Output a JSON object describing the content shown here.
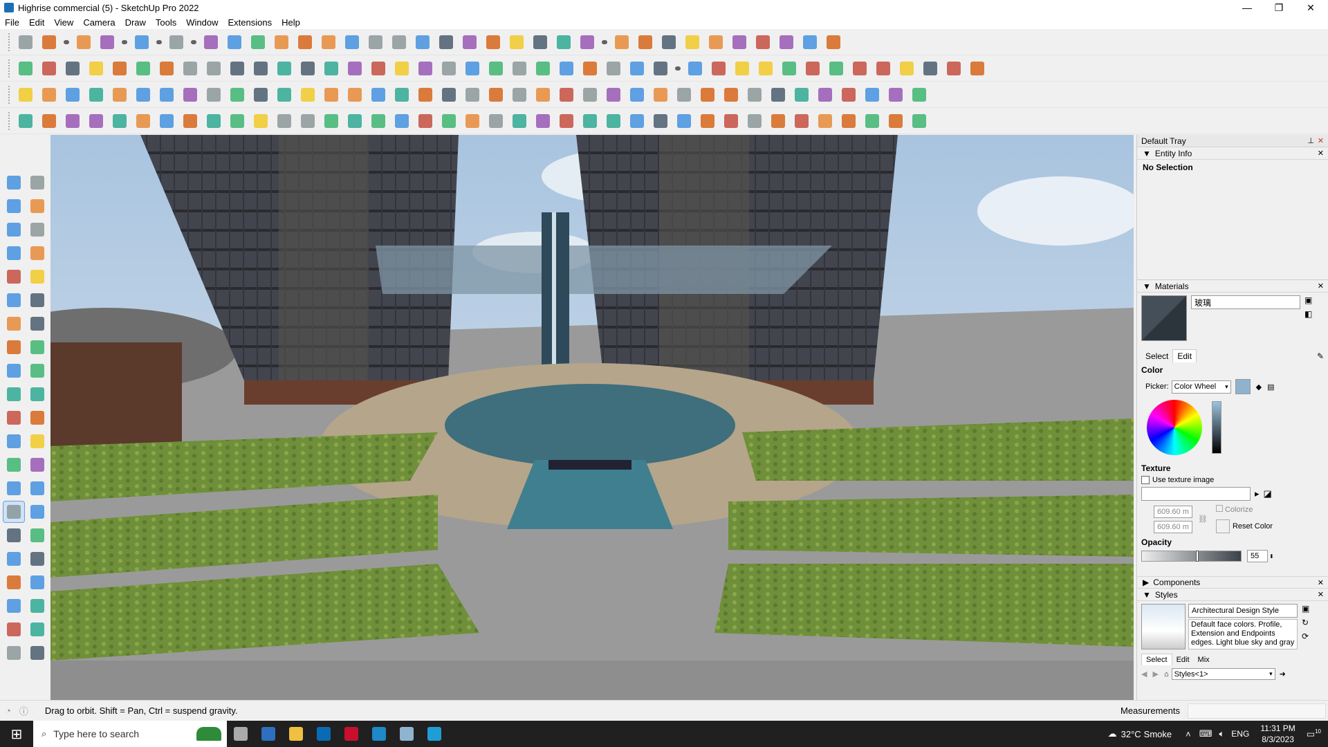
{
  "window": {
    "title": "Highrise commercial (5) - SketchUp Pro 2022",
    "minimize_icon": "minimize-icon",
    "maximize_icon": "maximize-icon",
    "close_icon": "close-icon",
    "minimize_glyph": "—",
    "maximize_glyph": "❐",
    "close_glyph": "✕"
  },
  "menubar": {
    "items": [
      "File",
      "Edit",
      "View",
      "Camera",
      "Draw",
      "Tools",
      "Window",
      "Extensions",
      "Help"
    ]
  },
  "toolbars": {
    "row1_icons": [
      "zoom-window-icon",
      "select-icon",
      "select-dropdown-icon",
      "eraser-icon",
      "pencil-line-icon",
      "line-dropdown-icon",
      "freehand-lasso-icon",
      "lasso-dropdown-icon",
      "shape-icon",
      "shape-dropdown-icon",
      "push-pull-icon",
      "follow-me-icon",
      "move-icon",
      "rotate-icon",
      "scale-icon",
      "tape-measure-icon",
      "text-icon",
      "paint-bucket-icon",
      "orbit-icon",
      "pan-icon",
      "zoom-icon",
      "zoom-extents-icon",
      "warehouse-icon",
      "extension-warehouse-icon",
      "layout-icon",
      "extension-manager-icon",
      "profile-icon",
      "profile-dropdown-icon",
      "sandbox-from-contours-icon",
      "sandbox-from-scratch-icon",
      "sandbox-smoove-icon",
      "sandbox-stamp-icon",
      "sandbox-drape-icon",
      "sandbox-add-detail-icon",
      "sandbox-flip-edge-icon",
      "undo-icon",
      "redo-icon",
      "hand-icon"
    ],
    "row2_icons": [
      "iso-view-icon",
      "top-view-icon",
      "front-view-icon",
      "component-icon",
      "group-icon",
      "section-plane-icon",
      "section-cut-icon",
      "section-fill-icon",
      "curve-icon",
      "solid-union-icon",
      "solid-subtract-icon",
      "solid-intersect-icon",
      "solid-trim-icon",
      "solid-split-icon",
      "outer-shell-icon",
      "sun-shadow-icon",
      "arrow-up-icon",
      "arrow-down-icon",
      "house-icon",
      "house-outline-icon",
      "building-icon",
      "roof-icon",
      "wall-icon",
      "floor-icon",
      "stair-icon",
      "window-icon",
      "door-icon",
      "fredo-icon",
      "dropdown-icon",
      "tag-icon",
      "knife-icon",
      "box-icon",
      "circle-icon",
      "polygon-icon",
      "ellipse-icon",
      "parallelogram-icon",
      "arc-icon",
      "spiral-icon",
      "star-icon",
      "curvilinear-icon",
      "joint-push-pull-icon",
      "hammer-icon"
    ],
    "row3_icons": [
      "plane-blue-icon",
      "plane-cyan-icon",
      "plane-yellow-icon",
      "plane-green-icon",
      "plane-red-icon",
      "plane-white-icon",
      "loop-icon",
      "square-red-icon",
      "frame-icon",
      "panel-icon",
      "wood-icon",
      "chain-icon",
      "corner-icon",
      "vertex-icon",
      "cross-red-icon",
      "cross-green-icon",
      "cross-blue-icon",
      "cone-icon",
      "fountain-icon",
      "triangle-icon",
      "spiral-orange-icon",
      "knot-icon",
      "circle-dashed-icon",
      "axes-icon",
      "cup-icon",
      "curl-icon",
      "tree-icon",
      "cube-red-icon",
      "cubes-icon",
      "cube-mixed-icon",
      "gem-icon",
      "grid-icon",
      "panel-blue-icon",
      "grid-orange-icon",
      "grid-yellow-icon",
      "grid-amber-icon",
      "dots-icon",
      "circle-dot-icon",
      "qr-icon"
    ],
    "row4_icons": [
      "curve-dashed-icon",
      "bezier-icon",
      "truck-icon",
      "scissors-icon",
      "gear-icon",
      "gear-outline-icon",
      "pipe-icon",
      "ring-icon",
      "sphere-icon",
      "cable-icon",
      "stair-line-icon",
      "step-icon",
      "divider-icon",
      "arc-red-icon",
      "arch-icon",
      "fan-icon",
      "bars-icon",
      "column-icon",
      "hand-outline-icon",
      "leaf-icon",
      "arrow-split-icon",
      "stack-icon",
      "blade-icon",
      "fork-icon",
      "rake-icon",
      "trident-icon",
      "sand-icon",
      "hatch-icon",
      "panel-gray-icon",
      "frame-gray-icon",
      "fence-icon",
      "mesh-icon",
      "grid-gray-icon",
      "comb-icon",
      "gear-dark-icon",
      "fan-dark-icon",
      "spikes-icon",
      "city-icon",
      "cube-outline-icon"
    ]
  },
  "left_toolbar_icons": [
    "select-icon",
    "make-component-icon",
    "paint-bucket-icon",
    "eraser-icon",
    "tag-tool-icon",
    "pencil-icon",
    "line-icon",
    "freehand-icon",
    "rectangle-icon",
    "rotated-rectangle-icon",
    "circle-icon",
    "polygon-icon",
    "arc-icon",
    "two-point-arc-icon",
    "three-point-arc-icon",
    "pie-icon",
    "move-icon",
    "push-pull-icon",
    "rotate-icon",
    "follow-me-icon",
    "scale-icon",
    "offset-icon",
    "tape-measure-icon",
    "dimension-icon",
    "protractor-icon",
    "text-icon",
    "axes-icon",
    "3d-text-icon",
    "orbit-icon",
    "pan-icon",
    "zoom-icon",
    "zoom-window-icon",
    "zoom-extents-icon",
    "previous-view-icon",
    "position-camera-icon",
    "look-around-icon",
    "walk-icon",
    "section-plane-icon",
    "warehouse-icon",
    "extension-warehouse-icon",
    "layout-send-icon",
    "extension-manager-icon"
  ],
  "active_tool": "orbit-icon",
  "tray": {
    "title": "Default Tray",
    "pin_icon": "pin-icon",
    "close_icon": "close-icon",
    "entity_info": {
      "label": "Entity Info",
      "selection": "No Selection"
    },
    "materials": {
      "label": "Materials",
      "name_value": "玻璃",
      "swatch_color": "#2f3a44",
      "tabs": [
        "Select",
        "Edit"
      ],
      "active_tab": "Edit",
      "color_section": "Color",
      "picker_label": "Picker:",
      "picker_value": "Color Wheel",
      "picker_options": [
        "Color Wheel"
      ],
      "current_color": "#8fb2cf",
      "texture_section": "Texture",
      "use_texture_label": "Use texture image",
      "use_texture_checked": false,
      "texture_path": "",
      "width_value": "609.60 m",
      "height_value": "609.60 m",
      "colorize_label": "Colorize",
      "reset_color_label": "Reset Color",
      "opacity_section": "Opacity",
      "opacity_value": "55"
    },
    "components": {
      "label": "Components"
    },
    "styles": {
      "label": "Styles",
      "name_value": "Architectural Design Style",
      "description": "Default face colors. Profile, Extension and Endpoints edges. Light blue sky and gray",
      "tabs": [
        "Select",
        "Edit",
        "Mix"
      ],
      "active_tab": "Select",
      "collection_value": "Styles<1>"
    }
  },
  "statusbar": {
    "hint": "Drag to orbit. Shift = Pan, Ctrl = suspend gravity.",
    "measurements_label": "Measurements",
    "measurements_value": ""
  },
  "taskbar": {
    "search_placeholder": "Type here to search",
    "weather_temp": "32°C",
    "weather_desc": "Smoke",
    "language": "ENG",
    "time": "11:31 PM",
    "date": "8/3/2023",
    "notification_count": "10",
    "apps": [
      "task-view-icon",
      "calculator-icon",
      "file-explorer-icon",
      "sketchup-icon",
      "acrobat-icon",
      "edge-icon",
      "snipping-tool-icon",
      "app-3-icon"
    ]
  }
}
